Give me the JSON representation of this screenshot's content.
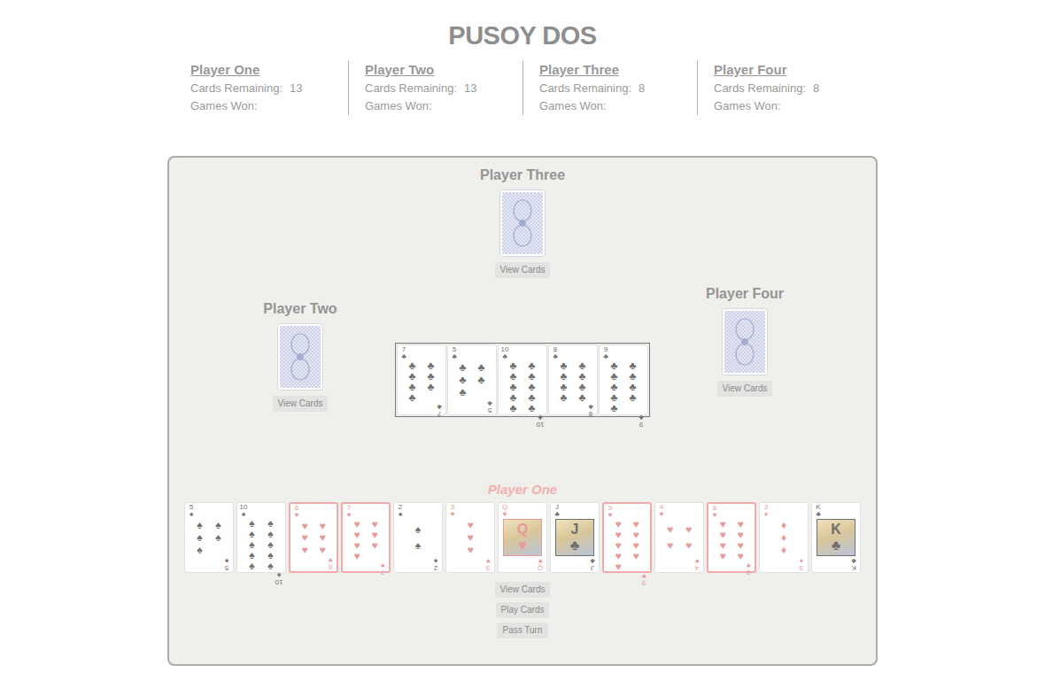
{
  "title": "PUSOY DOS",
  "players": [
    {
      "name": "Player One",
      "remaining_label": "Cards Remaining:",
      "remaining": "13",
      "won_label": "Games Won:"
    },
    {
      "name": "Player Two",
      "remaining_label": "Cards Remaining:",
      "remaining": "13",
      "won_label": "Games Won:"
    },
    {
      "name": "Player Three",
      "remaining_label": "Cards Remaining:",
      "remaining": "8",
      "won_label": "Games Won:"
    },
    {
      "name": "Player Four",
      "remaining_label": "Cards Remaining:",
      "remaining": "8",
      "won_label": "Games Won:"
    }
  ],
  "top_player": {
    "name": "Player Three",
    "button": "View Cards"
  },
  "left_player": {
    "name": "Player Two",
    "button": "View Cards"
  },
  "right_player": {
    "name": "Player Four",
    "button": "View Cards"
  },
  "pile": [
    {
      "rank": "7",
      "suit": "♣",
      "color": "#6f6f6f",
      "kind": "pips"
    },
    {
      "rank": "5",
      "suit": "♣",
      "color": "#6f6f6f",
      "kind": "pips"
    },
    {
      "rank": "10",
      "suit": "♣",
      "color": "#6f6f6f",
      "kind": "pips"
    },
    {
      "rank": "8",
      "suit": "♣",
      "color": "#6f6f6f",
      "kind": "pips"
    },
    {
      "rank": "9",
      "suit": "♣",
      "color": "#6f6f6f",
      "kind": "pips"
    }
  ],
  "hand": {
    "name": "Player One",
    "active": true,
    "cards": [
      {
        "rank": "5",
        "suit": "♠",
        "color": "#6f6f6f",
        "kind": "pips",
        "selected": false
      },
      {
        "rank": "10",
        "suit": "♠",
        "color": "#6f6f6f",
        "kind": "pips",
        "selected": false
      },
      {
        "rank": "6",
        "suit": "♥",
        "color": "#e79a9a",
        "kind": "pips",
        "selected": true
      },
      {
        "rank": "7",
        "suit": "♥",
        "color": "#e79a9a",
        "kind": "pips",
        "selected": true
      },
      {
        "rank": "2",
        "suit": "♠",
        "color": "#6f6f6f",
        "kind": "pips",
        "selected": false
      },
      {
        "rank": "3",
        "suit": "♥",
        "color": "#e79a9a",
        "kind": "pips",
        "selected": false
      },
      {
        "rank": "Q",
        "suit": "♥",
        "color": "#e79a9a",
        "kind": "face",
        "selected": false
      },
      {
        "rank": "J",
        "suit": "♣",
        "color": "#6f6f6f",
        "kind": "face",
        "selected": false
      },
      {
        "rank": "9",
        "suit": "♥",
        "color": "#e79a9a",
        "kind": "pips",
        "selected": true
      },
      {
        "rank": "4",
        "suit": "♥",
        "color": "#e79a9a",
        "kind": "pips",
        "selected": false
      },
      {
        "rank": "8",
        "suit": "♥",
        "color": "#e79a9a",
        "kind": "pips",
        "selected": true
      },
      {
        "rank": "3",
        "suit": "♦",
        "color": "#e79a9a",
        "kind": "pips",
        "selected": false
      },
      {
        "rank": "K",
        "suit": "♣",
        "color": "#6f6f6f",
        "kind": "face",
        "selected": false
      }
    ],
    "buttons": [
      "View Cards",
      "Play Cards",
      "Pass Turn"
    ]
  }
}
